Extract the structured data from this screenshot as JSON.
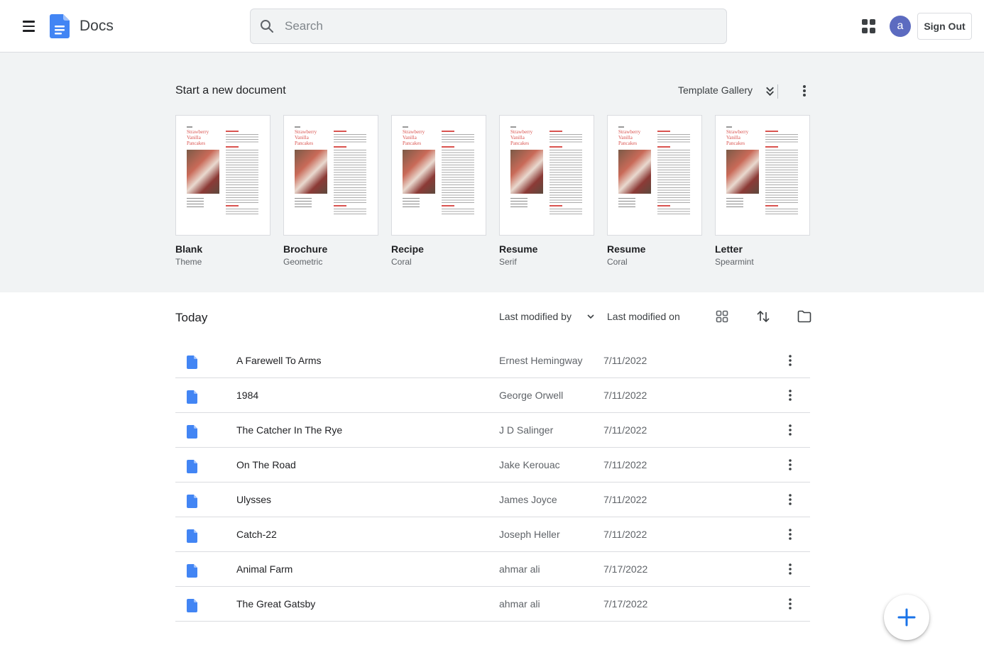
{
  "header": {
    "app_title": "Docs",
    "search_placeholder": "Search",
    "avatar_letter": "a",
    "sign_out_label": "Sign Out",
    "colors": {
      "brand_blue": "#4285f4",
      "avatar_bg": "#5c6bc0"
    }
  },
  "templates": {
    "heading": "Start a new document",
    "gallery_label": "Template Gallery",
    "thumb_title": "Strawberry Vanilla Pancakes",
    "items": [
      {
        "name": "Blank",
        "sub": "Theme"
      },
      {
        "name": "Brochure",
        "sub": "Geometric"
      },
      {
        "name": "Recipe",
        "sub": "Coral"
      },
      {
        "name": "Resume",
        "sub": "Serif"
      },
      {
        "name": "Resume",
        "sub": "Coral"
      },
      {
        "name": "Letter",
        "sub": "Spearmint"
      }
    ]
  },
  "documents": {
    "section_title": "Today",
    "col_modified_by": "Last modified by",
    "col_modified_on": "Last modified on",
    "rows": [
      {
        "title": "A Farewell To Arms",
        "owner": "Ernest Hemingway",
        "date": "7/11/2022"
      },
      {
        "title": "1984",
        "owner": "George Orwell",
        "date": "7/11/2022"
      },
      {
        "title": "The Catcher In The Rye",
        "owner": "J D Salinger",
        "date": "7/11/2022"
      },
      {
        "title": "On The Road",
        "owner": "Jake Kerouac",
        "date": "7/11/2022"
      },
      {
        "title": "Ulysses",
        "owner": "James Joyce",
        "date": "7/11/2022"
      },
      {
        "title": "Catch-22",
        "owner": "Joseph Heller",
        "date": "7/11/2022"
      },
      {
        "title": "Animal Farm",
        "owner": "ahmar ali",
        "date": "7/17/2022"
      },
      {
        "title": "The Great Gatsby",
        "owner": "ahmar ali",
        "date": "7/17/2022"
      }
    ]
  },
  "icons": {
    "menu": "hamburger-menu-icon",
    "logo": "docs-logo-icon",
    "search": "search-icon",
    "apps": "apps-grid-icon",
    "expand": "double-chevron-icon",
    "more": "more-vert-icon",
    "grid_view": "grid-view-icon",
    "sort": "sort-icon",
    "folder": "folder-icon",
    "doc": "document-icon",
    "new": "plus-icon"
  }
}
